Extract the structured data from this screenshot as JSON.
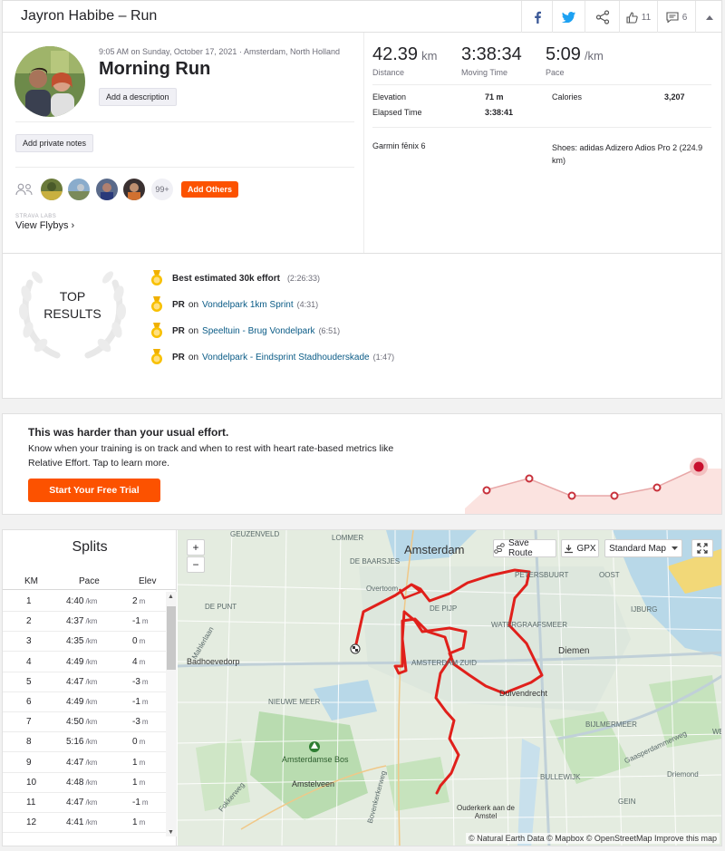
{
  "header": {
    "title": "Jayron Habibe – Run",
    "kudos_count": "11",
    "comments_count": "6"
  },
  "activity": {
    "datetime_location": "9:05 AM on Sunday, October 17, 2021 · Amsterdam, North Holland",
    "name": "Morning Run",
    "add_description": "Add a description",
    "add_private_notes": "Add private notes",
    "more_kudos": "99+",
    "add_others": "Add Others",
    "labs": "STRAVA LABS",
    "view_flybys": "View Flybys ›"
  },
  "stats": {
    "distance_value": "42.39",
    "distance_unit": "km",
    "distance_label": "Distance",
    "moving_time_value": "3:38:34",
    "moving_time_label": "Moving Time",
    "pace_value": "5:09",
    "pace_unit": "/km",
    "pace_label": "Pace",
    "elevation_label": "Elevation",
    "elevation_value": "71 m",
    "calories_label": "Calories",
    "calories_value": "3,207",
    "elapsed_label": "Elapsed Time",
    "elapsed_value": "3:38:41",
    "device": "Garmin fēnix 6",
    "shoes": "Shoes: adidas Adizero Adios Pro 2 (224.9 km)"
  },
  "top_results": {
    "heading_line1": "TOP",
    "heading_line2": "RESULTS",
    "items": [
      {
        "label": "Best estimated 30k effort",
        "prefix": "",
        "segment": "",
        "time": "(2:26:33)"
      },
      {
        "label": "PR",
        "prefix": "on",
        "segment": "Vondelpark 1km Sprint",
        "time": "(4:31)"
      },
      {
        "label": "PR",
        "prefix": "on",
        "segment": "Speeltuin - Brug Vondelpark",
        "time": "(6:51)"
      },
      {
        "label": "PR",
        "prefix": "on",
        "segment": "Vondelpark - Eindsprint Stadhouderskade",
        "time": "(1:47)"
      }
    ]
  },
  "promo": {
    "heading": "This was harder than your usual effort.",
    "body": "Know when your training is on track and when to rest with heart rate-based metrics like Relative Effort. Tap to learn more.",
    "button": "Start Your Free Trial",
    "accent": "#fc5200"
  },
  "splits": {
    "title": "Splits",
    "columns": [
      "KM",
      "Pace",
      "Elev"
    ],
    "pace_unit": "/km",
    "elev_unit": "m",
    "rows": [
      {
        "km": "1",
        "pace": "4:40",
        "elev": "2"
      },
      {
        "km": "2",
        "pace": "4:37",
        "elev": "-1"
      },
      {
        "km": "3",
        "pace": "4:35",
        "elev": "0"
      },
      {
        "km": "4",
        "pace": "4:49",
        "elev": "4"
      },
      {
        "km": "5",
        "pace": "4:47",
        "elev": "-3"
      },
      {
        "km": "6",
        "pace": "4:49",
        "elev": "-1"
      },
      {
        "km": "7",
        "pace": "4:50",
        "elev": "-3"
      },
      {
        "km": "8",
        "pace": "5:16",
        "elev": "0"
      },
      {
        "km": "9",
        "pace": "4:47",
        "elev": "1"
      },
      {
        "km": "10",
        "pace": "4:48",
        "elev": "1"
      },
      {
        "km": "11",
        "pace": "4:47",
        "elev": "-1"
      },
      {
        "km": "12",
        "pace": "4:41",
        "elev": "1"
      }
    ]
  },
  "map": {
    "zoom_in": "+",
    "zoom_out": "−",
    "save_route": "Save Route",
    "gpx": "GPX",
    "map_style": "Standard Map",
    "attribution": "© Natural Earth Data © Mapbox © OpenStreetMap Improve this map",
    "route_color": "#e0201b",
    "labels": {
      "amsterdam": "Amsterdam",
      "lommer": "LOMMER",
      "geuzenveld": "GEUZENVELD",
      "baarsjes": "DE BAARSJES",
      "de_punt": "DE PUNT",
      "overtoomse": "Overtoom",
      "de_pijp": "DE PIJP",
      "waterg": "WATERGRAAFSMEER",
      "badhoevedorp": "Badhoevedorp",
      "amsterdam_zuid": "AMSTERDAM ZUID",
      "diemen": "Diemen",
      "duivendrecht": "Duivendrecht",
      "nieuwe_meer": "NIEUWE MEER",
      "bos": "Amsterdamse Bos",
      "amstelveen": "Amstelveen",
      "bijlmermeer": "BIJLMERMEER",
      "bullewijk": "BULLEWIJK",
      "ouderkerk": "Ouderkerk aan de Amstel",
      "driemond": "Driemond",
      "gein": "GEIN",
      "ijburg": "IJBURG",
      "weesp": "WEES",
      "oost": "OOST",
      "petersbuurt": "PETERSBUURT",
      "mahlerlaan": "Mahlerlaan",
      "fokkerweg": "Fokkerweg",
      "gaasper": "Gaasperdammerweg",
      "bovenkerk": "Bovenkerkerweg"
    }
  }
}
